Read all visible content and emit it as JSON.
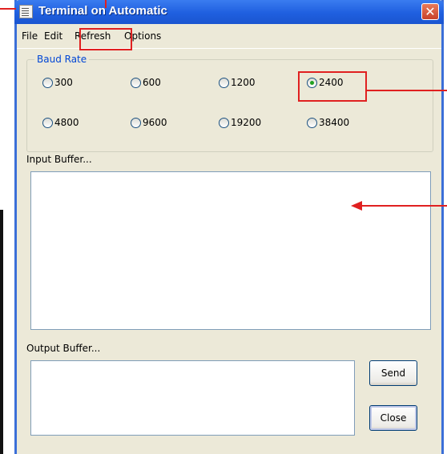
{
  "window": {
    "title": "Terminal on Automatic"
  },
  "menu": {
    "items": [
      "File",
      "Edit",
      "Refresh",
      "Options"
    ]
  },
  "baud_rate": {
    "group_label": "Baud Rate",
    "options": [
      "300",
      "600",
      "1200",
      "2400",
      "4800",
      "9600",
      "19200",
      "38400"
    ],
    "selected": "2400"
  },
  "input_buffer": {
    "label": "Input Buffer...",
    "value": ""
  },
  "output_buffer": {
    "label": "Output Buffer...",
    "value": ""
  },
  "buttons": {
    "send": "Send",
    "close": "Close"
  },
  "colors": {
    "titlebar": "#1f5fdf",
    "window_bg": "#ece9d8",
    "annotation": "#e02020",
    "group_title": "#0046d5",
    "radio_dot": "#21a121"
  },
  "icons": {
    "window_icon": "notepad-icon",
    "close_icon": "close-icon"
  }
}
